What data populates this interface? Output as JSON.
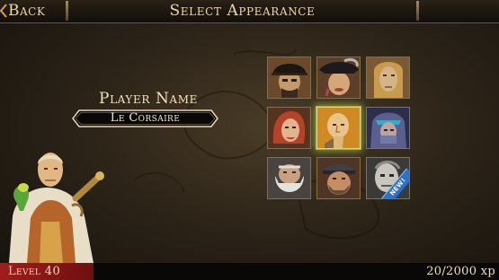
{
  "header": {
    "back_label": "Back",
    "title": "Select Appearance"
  },
  "player": {
    "heading": "Player Name",
    "name": "Le Corsaire"
  },
  "portraits": [
    {
      "id": "pirate-captain",
      "selected": false,
      "new": false
    },
    {
      "id": "plumed-hat",
      "selected": false,
      "new": false
    },
    {
      "id": "blond-long-hair",
      "selected": false,
      "new": false
    },
    {
      "id": "red-haired-woman",
      "selected": false,
      "new": false
    },
    {
      "id": "bald-elder",
      "selected": true,
      "new": false
    },
    {
      "id": "hooded-warrior",
      "selected": false,
      "new": false
    },
    {
      "id": "bearded-dwarf",
      "selected": false,
      "new": false
    },
    {
      "id": "capped-brute",
      "selected": false,
      "new": false
    },
    {
      "id": "pale-golem",
      "selected": false,
      "new": true,
      "badge": "NEW!"
    }
  ],
  "status": {
    "level_text": "Level 40",
    "xp_text": "20/2000 xp"
  },
  "colors": {
    "parchment_text": "#ead9b0",
    "gold_border": "#8c6f3c",
    "selected_glow": "#8fa23a",
    "level_red": "#a11d1d",
    "new_badge_blue": "#2f6fc4"
  }
}
